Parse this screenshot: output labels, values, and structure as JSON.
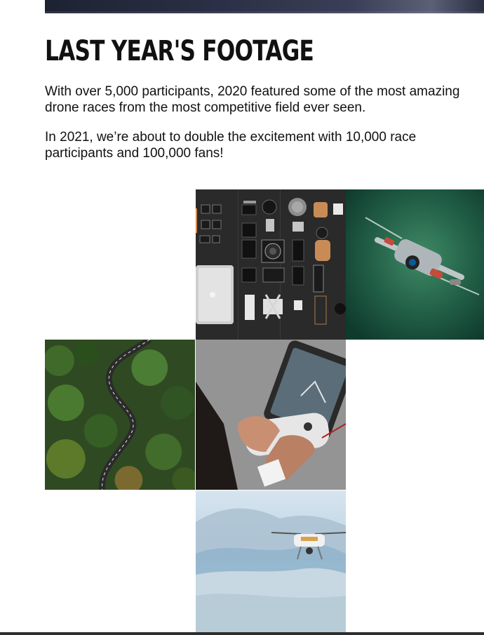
{
  "section": {
    "title": "LAST YEAR'S FOOTAGE",
    "paragraphs": [
      "With over 5,000 participants, 2020 featured some of the most amazing drone races from the most competitive field ever seen.",
      "In 2021, we’re about to double the excitement with 10,000 race participants and 100,000 fans!"
    ]
  },
  "gallery": {
    "images": [
      {
        "subject": "camera gear flat lay"
      },
      {
        "subject": "drone in flight over green background"
      },
      {
        "subject": "aerial view of winding road through forest"
      },
      {
        "subject": "hands holding drone controller with tablet"
      },
      {
        "subject": "drone flying over misty mountains"
      }
    ]
  },
  "colors": {
    "text": "#111111",
    "background": "#ffffff",
    "hero_strip": "#2b3046",
    "footer_strip": "#2e2e2e"
  }
}
